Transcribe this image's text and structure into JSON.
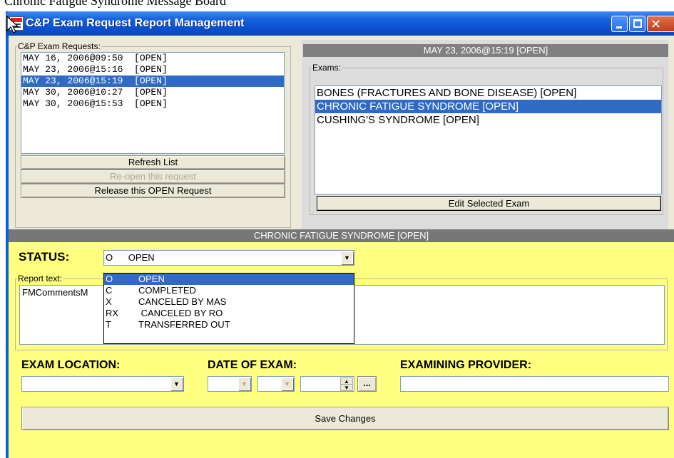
{
  "background_caption": "Chronic Fatigue Syndrome Message Board",
  "window": {
    "title": "C&P Exam Request Report Management"
  },
  "requests": {
    "legend": "C&P Exam Requests:",
    "items": [
      "MAY 16, 2006@09:50  [OPEN]",
      "MAY 23, 2006@15:16  [OPEN]",
      "MAY 23, 2006@15:19  [OPEN]",
      "MAY 30, 2006@10:27  [OPEN]",
      "MAY 30, 2006@15:53  [OPEN]"
    ],
    "selected_index": 2,
    "refresh_label": "Refresh List",
    "reopen_label": "Re-open this request",
    "release_label": "Release this OPEN Request"
  },
  "selected_request": {
    "header": "MAY 23, 2006@15:19  [OPEN]"
  },
  "exams": {
    "legend": "Exams:",
    "items": [
      "BONES (FRACTURES AND BONE DISEASE) [OPEN]",
      "CHRONIC FATIGUE SYNDROME [OPEN]",
      "CUSHING'S SYNDROME [OPEN]"
    ],
    "selected_index": 1,
    "edit_label": "Edit Selected Exam"
  },
  "exam_header": "CHRONIC FATIGUE SYNDROME [OPEN]",
  "status": {
    "label": "STATUS:",
    "current": "O      OPEN",
    "options": [
      {
        "code": "O",
        "label": "OPEN"
      },
      {
        "code": "C",
        "label": "COMPLETED"
      },
      {
        "code": "X",
        "label": "CANCELED BY MAS"
      },
      {
        "code": "RX",
        "label": " CANCELED BY RO"
      },
      {
        "code": "T",
        "label": "TRANSFERRED OUT"
      }
    ],
    "selected_index": 0
  },
  "report": {
    "legend": "Report text:",
    "text": "FMCommentsM"
  },
  "exam_location": {
    "label": "EXAM LOCATION:",
    "value": ""
  },
  "date_of_exam": {
    "label": "DATE OF EXAM:",
    "ellipsis": "..."
  },
  "examining_provider": {
    "label": "EXAMINING PROVIDER:",
    "value": ""
  },
  "save_label": "Save Changes",
  "icons": [
    "app-icon",
    "mouse-cursor-icon",
    "minimize-icon",
    "maximize-icon",
    "close-icon",
    "dropdown-arrow-icon",
    "spin-up-icon",
    "spin-down-icon"
  ],
  "colors": {
    "titlebar": "#0a4fd0",
    "selection": "#316ac5",
    "yellow_panel": "#ffff80",
    "band": "#808080"
  }
}
